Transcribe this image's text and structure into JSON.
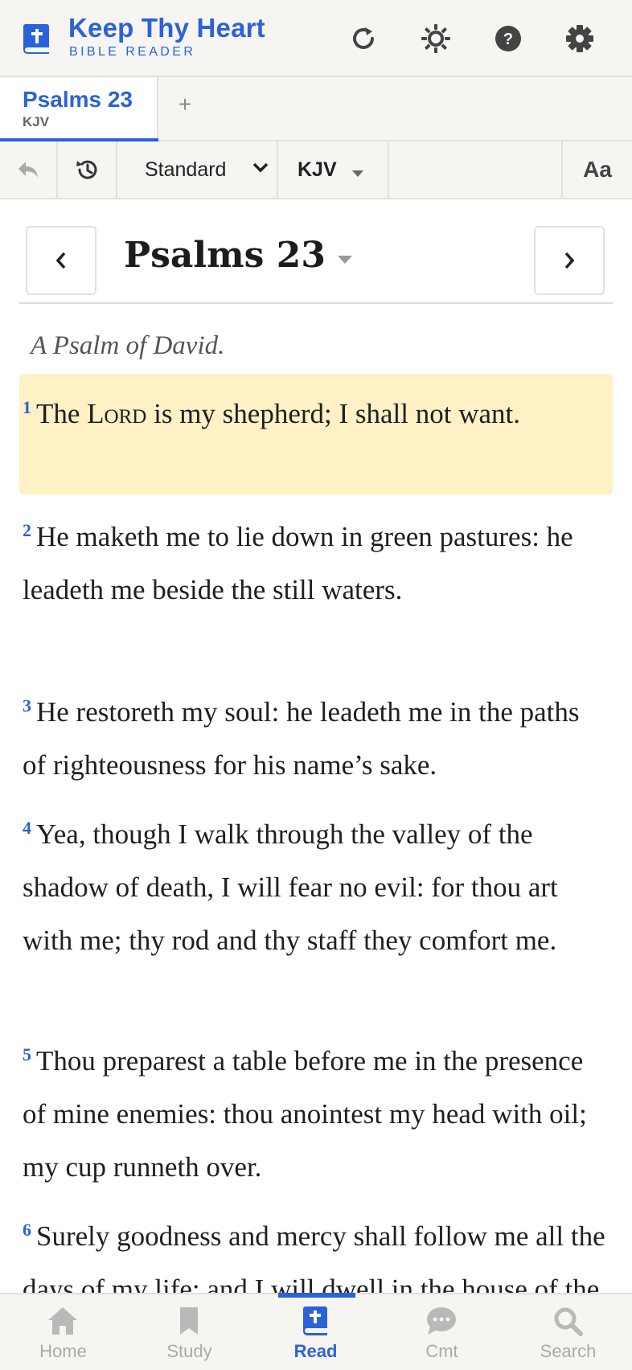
{
  "header": {
    "title": "Keep Thy Heart",
    "subtitle": "BIBLE READER",
    "buttons": [
      "refresh-icon",
      "brightness-icon",
      "help-icon",
      "settings-icon"
    ],
    "accent_color": "#2a62d9"
  },
  "tabs": {
    "active": {
      "title": "Psalms 23",
      "version": "KJV"
    },
    "add_label": "+"
  },
  "toolbar": {
    "back_icon": "back-arrow-icon",
    "history_icon": "history-icon",
    "mode_selected": "Standard",
    "version_selected": "KJV",
    "font_label": "Aa"
  },
  "chapter": {
    "title": "Psalms 23",
    "prev_icon": "chevron-left-icon",
    "next_icon": "chevron-right-icon",
    "superscription": "A Psalm of David."
  },
  "verses": [
    {
      "num": "1",
      "before": "The ",
      "lord": "Lord",
      "after": " is my shepherd; I shall not want.",
      "highlighted": true,
      "highlight_color": "#fdf1c5"
    },
    {
      "num": "2",
      "text": "He maketh me to lie down in green pastures: he leadeth me beside the still waters."
    },
    {
      "num": "3",
      "text": "He restoreth my soul: he leadeth me in the paths of righteousness for his name’s sake."
    },
    {
      "num": "4",
      "text": "Yea, though I walk through the valley of the shadow of death, I will fear no evil: for thou art with me; thy rod and thy staff they comfort me."
    },
    {
      "num": "5",
      "text": "Thou preparest a table before me in the presence of mine enemies: thou anointest my head with oil; my cup runneth over."
    },
    {
      "num": "6",
      "text": "Surely goodness and mercy shall follow me all the days of my life: and I will dwell in the house of the Lord for ever."
    }
  ],
  "bottom_nav": [
    {
      "label": "Home",
      "icon": "home-icon"
    },
    {
      "label": "Study",
      "icon": "bookmark-icon"
    },
    {
      "label": "Read",
      "icon": "bible-icon",
      "active": true
    },
    {
      "label": "Cmt",
      "icon": "comment-icon"
    },
    {
      "label": "Search",
      "icon": "search-icon"
    }
  ]
}
